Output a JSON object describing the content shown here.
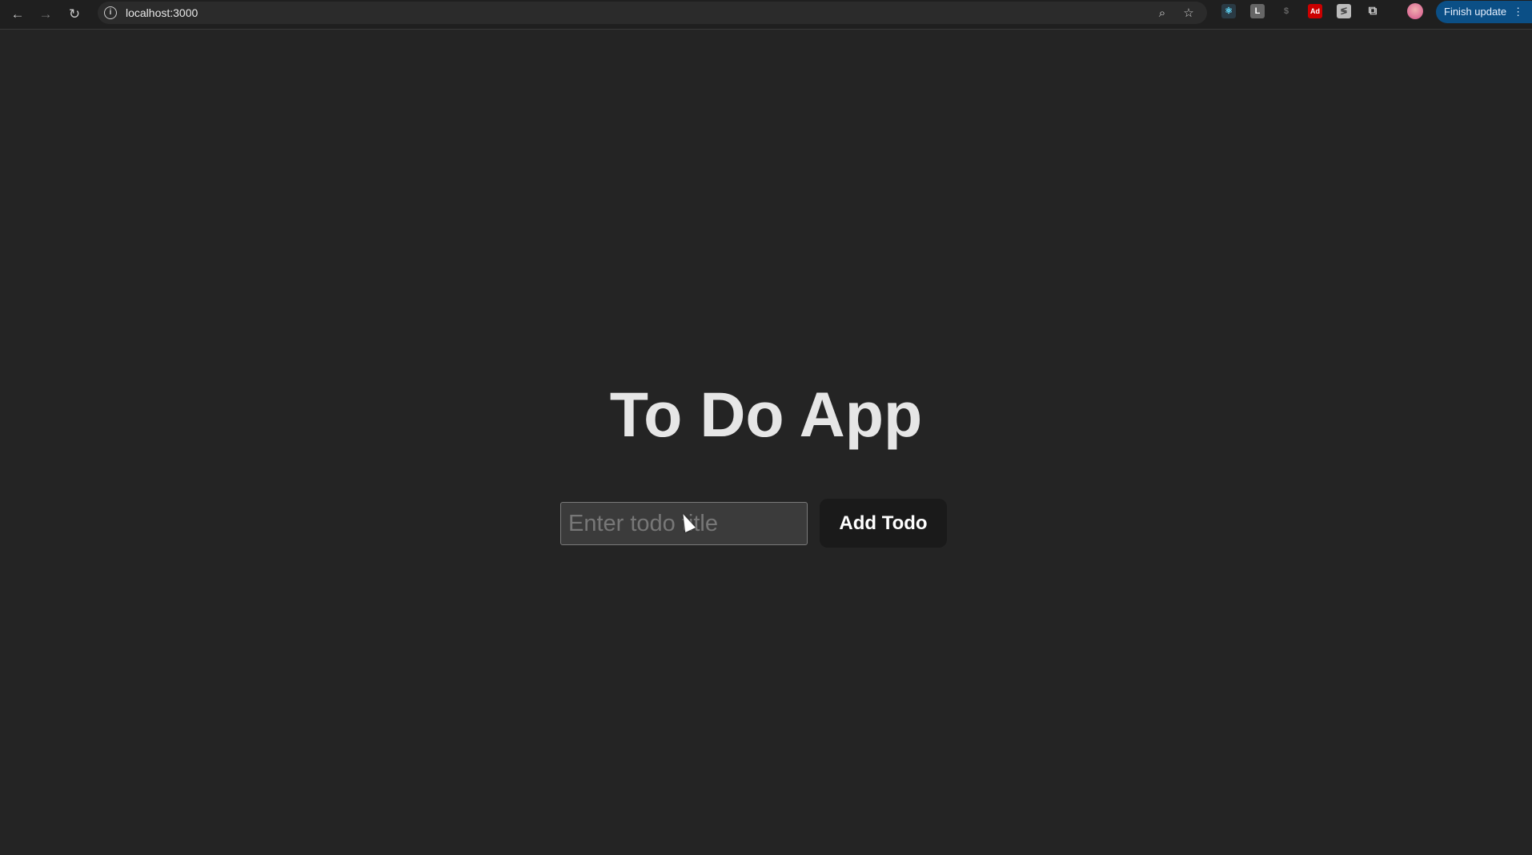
{
  "browser": {
    "url": "localhost:3000",
    "finish_update_label": "Finish update",
    "extensions": [
      "react-devtools",
      "L",
      "ad-block",
      "stylus"
    ],
    "ext_L_label": "L",
    "ext_ad_label": "Ad"
  },
  "app": {
    "title": "To Do App",
    "input_placeholder": "Enter todo title",
    "input_value": "",
    "add_button_label": "Add Todo"
  }
}
